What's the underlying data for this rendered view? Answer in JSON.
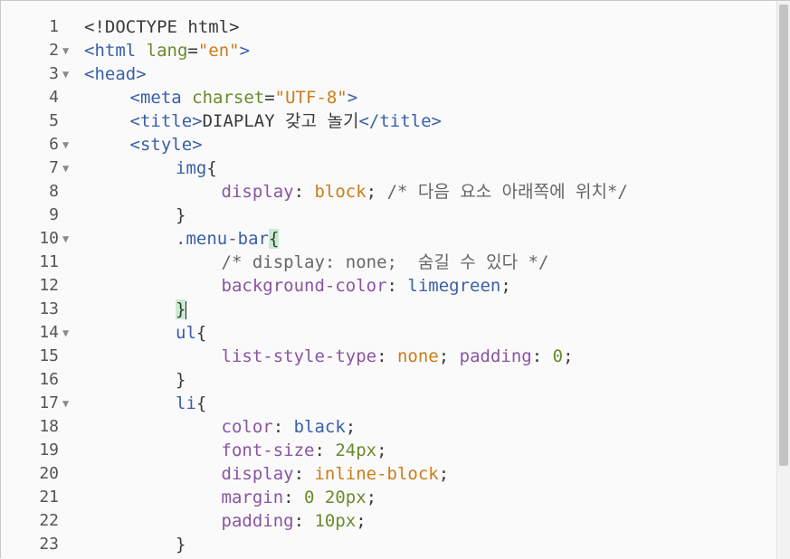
{
  "editor": {
    "lines": [
      {
        "num": "1",
        "fold": false,
        "indent": 0,
        "tokens": [
          [
            "t-plain",
            "<!DOCTYPE html>"
          ]
        ]
      },
      {
        "num": "2",
        "fold": true,
        "indent": 0,
        "tokens": [
          [
            "t-tag",
            "<html "
          ],
          [
            "t-attr",
            "lang"
          ],
          [
            "t-plain",
            "="
          ],
          [
            "t-str",
            "\"en\""
          ],
          [
            "t-tag",
            ">"
          ]
        ]
      },
      {
        "num": "3",
        "fold": true,
        "indent": 0,
        "tokens": [
          [
            "t-tag",
            "<head>"
          ]
        ]
      },
      {
        "num": "4",
        "fold": false,
        "indent": 1,
        "tokens": [
          [
            "t-tag",
            "<meta "
          ],
          [
            "t-attr",
            "charset"
          ],
          [
            "t-plain",
            "="
          ],
          [
            "t-str",
            "\"UTF-8\""
          ],
          [
            "t-tag",
            ">"
          ]
        ]
      },
      {
        "num": "5",
        "fold": false,
        "indent": 1,
        "tokens": [
          [
            "t-tag",
            "<title>"
          ],
          [
            "t-plain",
            "DIAPLAY 갖고 놀기"
          ],
          [
            "t-tag",
            "</title>"
          ]
        ]
      },
      {
        "num": "6",
        "fold": true,
        "indent": 1,
        "tokens": [
          [
            "t-tag",
            "<style>"
          ]
        ]
      },
      {
        "num": "7",
        "fold": true,
        "indent": 2,
        "tokens": [
          [
            "t-sel",
            "img"
          ],
          [
            "t-brace",
            "{"
          ]
        ]
      },
      {
        "num": "8",
        "fold": false,
        "indent": 3,
        "tokens": [
          [
            "t-prop",
            "display"
          ],
          [
            "t-plain",
            ": "
          ],
          [
            "t-key",
            "block"
          ],
          [
            "t-plain",
            "; "
          ],
          [
            "t-com",
            "/* 다음 요소 아래쪽에 위치*/"
          ]
        ]
      },
      {
        "num": "9",
        "fold": false,
        "indent": 2,
        "tokens": [
          [
            "t-brace",
            "}"
          ]
        ]
      },
      {
        "num": "10",
        "fold": true,
        "indent": 2,
        "tokens": [
          [
            "t-sel",
            ".menu-bar"
          ],
          [
            "hl-brace",
            "{"
          ]
        ]
      },
      {
        "num": "11",
        "fold": false,
        "indent": 3,
        "tokens": [
          [
            "t-com",
            "/* display: none;  숨길 수 있다 */"
          ]
        ]
      },
      {
        "num": "12",
        "fold": false,
        "indent": 3,
        "tokens": [
          [
            "t-prop",
            "background-color"
          ],
          [
            "t-plain",
            ": "
          ],
          [
            "t-val",
            "limegreen"
          ],
          [
            "t-plain",
            ";"
          ]
        ]
      },
      {
        "num": "13",
        "fold": false,
        "indent": 2,
        "tokens": [
          [
            "hl-brace",
            "}"
          ],
          [
            "cursor",
            ""
          ]
        ]
      },
      {
        "num": "14",
        "fold": true,
        "indent": 2,
        "tokens": [
          [
            "t-sel",
            "ul"
          ],
          [
            "t-brace",
            "{"
          ]
        ]
      },
      {
        "num": "15",
        "fold": false,
        "indent": 3,
        "tokens": [
          [
            "t-prop",
            "list-style-type"
          ],
          [
            "t-plain",
            ": "
          ],
          [
            "t-key",
            "none"
          ],
          [
            "t-plain",
            "; "
          ],
          [
            "t-prop",
            "padding"
          ],
          [
            "t-plain",
            ": "
          ],
          [
            "t-num",
            "0"
          ],
          [
            "t-plain",
            ";"
          ]
        ]
      },
      {
        "num": "16",
        "fold": false,
        "indent": 2,
        "tokens": [
          [
            "t-brace",
            "}"
          ]
        ]
      },
      {
        "num": "17",
        "fold": true,
        "indent": 2,
        "tokens": [
          [
            "t-sel",
            "li"
          ],
          [
            "t-brace",
            "{"
          ]
        ]
      },
      {
        "num": "18",
        "fold": false,
        "indent": 3,
        "tokens": [
          [
            "t-prop",
            "color"
          ],
          [
            "t-plain",
            ": "
          ],
          [
            "t-val",
            "black"
          ],
          [
            "t-plain",
            ";"
          ]
        ]
      },
      {
        "num": "19",
        "fold": false,
        "indent": 3,
        "tokens": [
          [
            "t-prop",
            "font-size"
          ],
          [
            "t-plain",
            ": "
          ],
          [
            "t-num",
            "24px"
          ],
          [
            "t-plain",
            ";"
          ]
        ]
      },
      {
        "num": "20",
        "fold": false,
        "indent": 3,
        "tokens": [
          [
            "t-prop",
            "display"
          ],
          [
            "t-plain",
            ": "
          ],
          [
            "t-key",
            "inline-block"
          ],
          [
            "t-plain",
            ";"
          ]
        ]
      },
      {
        "num": "21",
        "fold": false,
        "indent": 3,
        "tokens": [
          [
            "t-prop",
            "margin"
          ],
          [
            "t-plain",
            ": "
          ],
          [
            "t-num",
            "0 20px"
          ],
          [
            "t-plain",
            ";"
          ]
        ]
      },
      {
        "num": "22",
        "fold": false,
        "indent": 3,
        "tokens": [
          [
            "t-prop",
            "padding"
          ],
          [
            "t-plain",
            ": "
          ],
          [
            "t-num",
            "10px"
          ],
          [
            "t-plain",
            ";"
          ]
        ]
      },
      {
        "num": "23",
        "fold": false,
        "indent": 2,
        "tokens": [
          [
            "t-brace",
            "}"
          ]
        ]
      }
    ]
  },
  "scroll": {
    "position": 0.0
  }
}
